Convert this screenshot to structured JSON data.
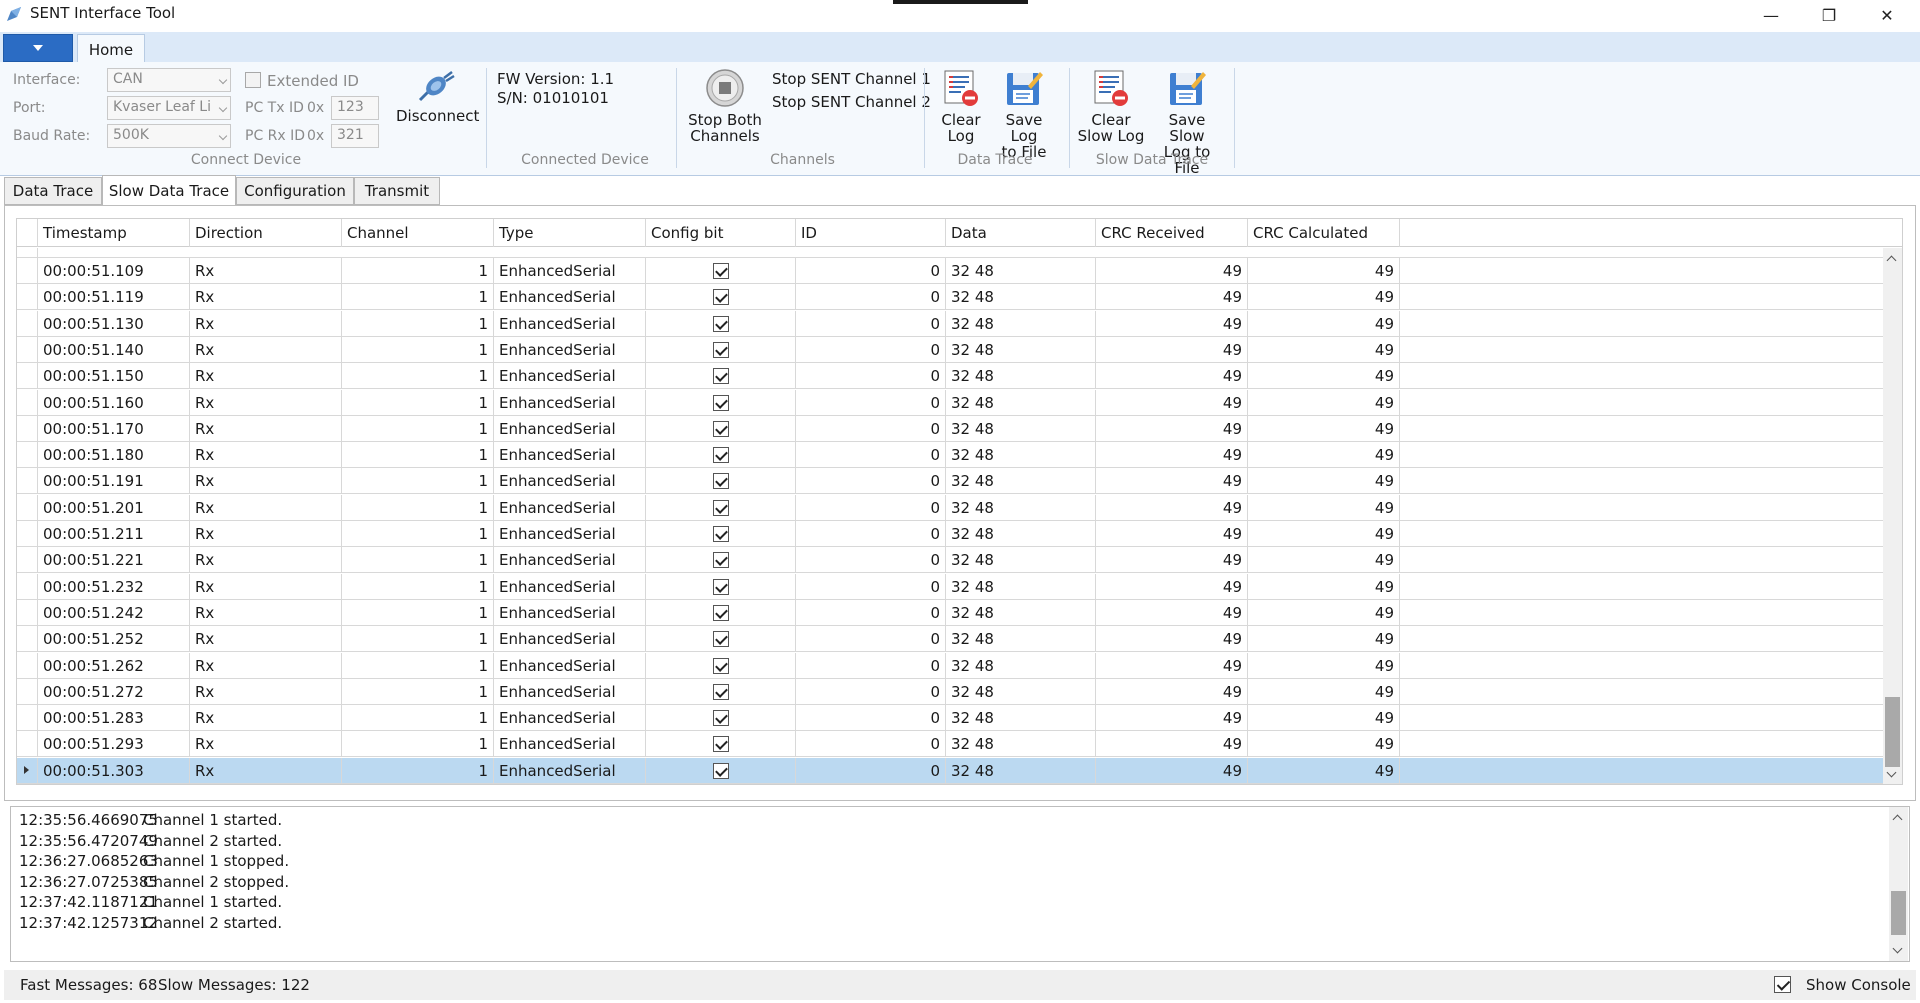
{
  "window": {
    "title": "SENT Interface Tool",
    "minimize_glyph": "—",
    "restore_glyph": "❐",
    "close_glyph": "✕"
  },
  "ribbon": {
    "home_tab": "Home",
    "connect_device": {
      "group_label": "Connect Device",
      "interface_label": "Interface:",
      "interface_value": "CAN",
      "port_label": "Port:",
      "port_value": "Kvaser Leaf Li",
      "baud_label": "Baud Rate:",
      "baud_value": "500K",
      "extended_id_label": "Extended ID",
      "extended_id_checked": false,
      "pc_tx_label": "PC Tx ID",
      "pc_tx_prefix": "0x",
      "pc_tx_value": "123",
      "pc_rx_label": "PC Rx ID",
      "pc_rx_prefix": "0x",
      "pc_rx_value": "321",
      "disconnect_label": "Disconnect"
    },
    "connected_device": {
      "group_label": "Connected Device",
      "fw_version": "FW Version: 1.1",
      "serial": "S/N: 01010101"
    },
    "channels": {
      "group_label": "Channels",
      "stop_both_line1": "Stop Both",
      "stop_both_line2": "Channels",
      "stop_ch1": "Stop SENT Channel 1",
      "stop_ch2": "Stop SENT Channel 2"
    },
    "data_trace": {
      "group_label": "Data Trace",
      "clear_line1": "Clear",
      "clear_line2": "Log",
      "save_line1": "Save Log",
      "save_line2": "to File"
    },
    "slow_data_trace": {
      "group_label": "Slow Data Trace",
      "clear_line1": "Clear",
      "clear_line2": "Slow Log",
      "save_line1": "Save Slow",
      "save_line2": "Log to File"
    }
  },
  "doc_tabs": [
    "Data Trace",
    "Slow Data Trace",
    "Configuration",
    "Transmit"
  ],
  "active_tab": "Slow Data Trace",
  "grid": {
    "columns": [
      "Timestamp",
      "Direction",
      "Channel",
      "Type",
      "Config bit",
      "ID",
      "Data",
      "CRC Received",
      "CRC Calculated"
    ],
    "rows": [
      {
        "timestamp": "00:00:51.109",
        "direction": "Rx",
        "channel": "1",
        "type": "EnhancedSerial",
        "config": true,
        "id": "0",
        "data": "32 48",
        "crc_rx": "49",
        "crc_calc": "49"
      },
      {
        "timestamp": "00:00:51.119",
        "direction": "Rx",
        "channel": "1",
        "type": "EnhancedSerial",
        "config": true,
        "id": "0",
        "data": "32 48",
        "crc_rx": "49",
        "crc_calc": "49"
      },
      {
        "timestamp": "00:00:51.130",
        "direction": "Rx",
        "channel": "1",
        "type": "EnhancedSerial",
        "config": true,
        "id": "0",
        "data": "32 48",
        "crc_rx": "49",
        "crc_calc": "49"
      },
      {
        "timestamp": "00:00:51.140",
        "direction": "Rx",
        "channel": "1",
        "type": "EnhancedSerial",
        "config": true,
        "id": "0",
        "data": "32 48",
        "crc_rx": "49",
        "crc_calc": "49"
      },
      {
        "timestamp": "00:00:51.150",
        "direction": "Rx",
        "channel": "1",
        "type": "EnhancedSerial",
        "config": true,
        "id": "0",
        "data": "32 48",
        "crc_rx": "49",
        "crc_calc": "49"
      },
      {
        "timestamp": "00:00:51.160",
        "direction": "Rx",
        "channel": "1",
        "type": "EnhancedSerial",
        "config": true,
        "id": "0",
        "data": "32 48",
        "crc_rx": "49",
        "crc_calc": "49"
      },
      {
        "timestamp": "00:00:51.170",
        "direction": "Rx",
        "channel": "1",
        "type": "EnhancedSerial",
        "config": true,
        "id": "0",
        "data": "32 48",
        "crc_rx": "49",
        "crc_calc": "49"
      },
      {
        "timestamp": "00:00:51.180",
        "direction": "Rx",
        "channel": "1",
        "type": "EnhancedSerial",
        "config": true,
        "id": "0",
        "data": "32 48",
        "crc_rx": "49",
        "crc_calc": "49"
      },
      {
        "timestamp": "00:00:51.191",
        "direction": "Rx",
        "channel": "1",
        "type": "EnhancedSerial",
        "config": true,
        "id": "0",
        "data": "32 48",
        "crc_rx": "49",
        "crc_calc": "49"
      },
      {
        "timestamp": "00:00:51.201",
        "direction": "Rx",
        "channel": "1",
        "type": "EnhancedSerial",
        "config": true,
        "id": "0",
        "data": "32 48",
        "crc_rx": "49",
        "crc_calc": "49"
      },
      {
        "timestamp": "00:00:51.211",
        "direction": "Rx",
        "channel": "1",
        "type": "EnhancedSerial",
        "config": true,
        "id": "0",
        "data": "32 48",
        "crc_rx": "49",
        "crc_calc": "49"
      },
      {
        "timestamp": "00:00:51.221",
        "direction": "Rx",
        "channel": "1",
        "type": "EnhancedSerial",
        "config": true,
        "id": "0",
        "data": "32 48",
        "crc_rx": "49",
        "crc_calc": "49"
      },
      {
        "timestamp": "00:00:51.232",
        "direction": "Rx",
        "channel": "1",
        "type": "EnhancedSerial",
        "config": true,
        "id": "0",
        "data": "32 48",
        "crc_rx": "49",
        "crc_calc": "49"
      },
      {
        "timestamp": "00:00:51.242",
        "direction": "Rx",
        "channel": "1",
        "type": "EnhancedSerial",
        "config": true,
        "id": "0",
        "data": "32 48",
        "crc_rx": "49",
        "crc_calc": "49"
      },
      {
        "timestamp": "00:00:51.252",
        "direction": "Rx",
        "channel": "1",
        "type": "EnhancedSerial",
        "config": true,
        "id": "0",
        "data": "32 48",
        "crc_rx": "49",
        "crc_calc": "49"
      },
      {
        "timestamp": "00:00:51.262",
        "direction": "Rx",
        "channel": "1",
        "type": "EnhancedSerial",
        "config": true,
        "id": "0",
        "data": "32 48",
        "crc_rx": "49",
        "crc_calc": "49"
      },
      {
        "timestamp": "00:00:51.272",
        "direction": "Rx",
        "channel": "1",
        "type": "EnhancedSerial",
        "config": true,
        "id": "0",
        "data": "32 48",
        "crc_rx": "49",
        "crc_calc": "49"
      },
      {
        "timestamp": "00:00:51.283",
        "direction": "Rx",
        "channel": "1",
        "type": "EnhancedSerial",
        "config": true,
        "id": "0",
        "data": "32 48",
        "crc_rx": "49",
        "crc_calc": "49"
      },
      {
        "timestamp": "00:00:51.293",
        "direction": "Rx",
        "channel": "1",
        "type": "EnhancedSerial",
        "config": true,
        "id": "0",
        "data": "32 48",
        "crc_rx": "49",
        "crc_calc": "49"
      },
      {
        "timestamp": "00:00:51.303",
        "direction": "Rx",
        "channel": "1",
        "type": "EnhancedSerial",
        "config": true,
        "id": "0",
        "data": "32 48",
        "crc_rx": "49",
        "crc_calc": "49",
        "selected": true
      }
    ]
  },
  "console": {
    "lines": [
      {
        "ts": "12:35:56.4669075",
        "msg": "Channel 1 started."
      },
      {
        "ts": "12:35:56.4720749",
        "msg": "Channel 2 started."
      },
      {
        "ts": "12:36:27.0685263",
        "msg": "Channel 1 stopped."
      },
      {
        "ts": "12:36:27.0725385",
        "msg": "Channel 2 stopped."
      },
      {
        "ts": "12:37:42.1187121",
        "msg": "Channel 1 started."
      },
      {
        "ts": "12:37:42.1257312",
        "msg": "Channel 2 started."
      }
    ]
  },
  "status": {
    "fast_messages": "Fast Messages: 68",
    "slow_messages": "Slow Messages: 122",
    "show_console_label": "Show Console",
    "show_console_checked": true
  },
  "colors": {
    "ribbon_bg": "#f5f9fd",
    "ribbon_tab_strip": "#dce9f8",
    "file_tab": "#2b6cc4",
    "selected_row": "#bbd9f1"
  }
}
